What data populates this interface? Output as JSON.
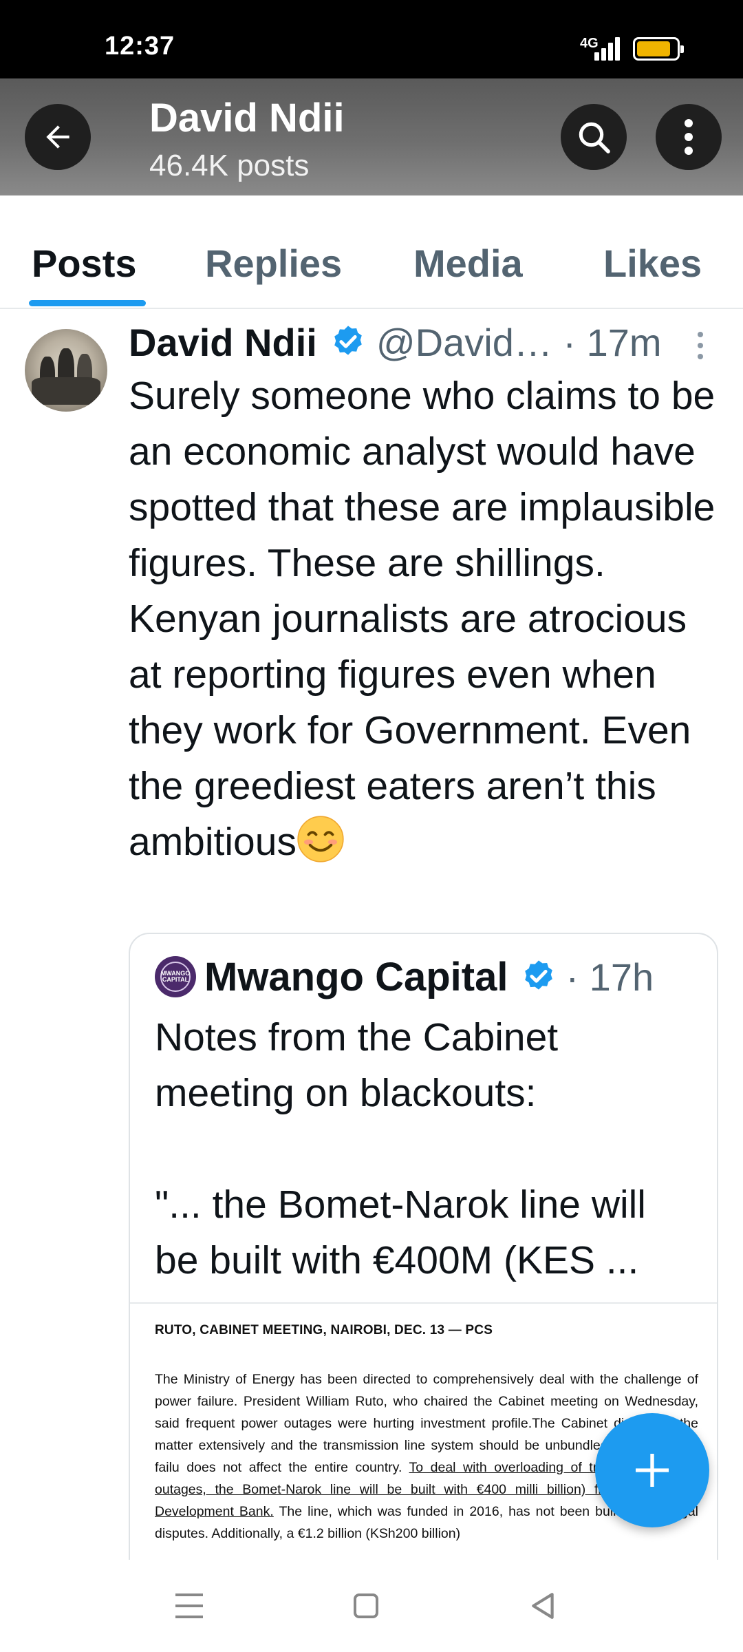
{
  "status_bar": {
    "time": "12:37",
    "network": "4G",
    "battery_color": "#f0b400",
    "battery_level": 0.85
  },
  "header": {
    "name": "David Ndii",
    "post_count": "46.4K posts",
    "back_icon": "arrow-left-icon",
    "search_icon": "search-icon",
    "more_icon": "vertical-dots-icon"
  },
  "tabs": {
    "items": [
      {
        "label": "Posts",
        "active": true
      },
      {
        "label": "Replies",
        "active": false
      },
      {
        "label": "Media",
        "active": false
      },
      {
        "label": "Likes",
        "active": false
      }
    ],
    "accent": "#1d9bf0"
  },
  "post": {
    "author": "David Ndii",
    "handle_time": "@David… · 17m",
    "text": "Surely someone who claims to be an economic analyst would have spotted that these are implausible figures. These are shillings. Kenyan journalists are atrocious at reporting figures even when they work for Government. Even the greediest eaters aren’t this ambitious",
    "emoji": "smiling-face-emoji"
  },
  "quote": {
    "author": "Mwango Capital",
    "time": "· 17h",
    "text_line1": "Notes from the Cabinet meeting  on blackouts:",
    "text_line2": "\"... the Bomet-Narok line will be built with €400M (KES ...",
    "document": {
      "heading": "RUTO, CABINET MEETING, NAIROBI, DEC. 13 — PCS",
      "body_plain": "The Ministry of Energy has been directed to comprehensively deal with the challenge of power failure. President William Ruto, who chaired the Cabinet meeting on Wednesday, said frequent power outages were hurting investment profile.The Cabinet discussed the matter extensively and the transmission line system should be unbundled so that power failu does not affect the entire country. ",
      "body_underlined": "To deal with overloading of trans that causes outages, the Bomet-Narok line will be built with €400 milli billion) from the African Development Bank.",
      "body_tail": " The line, which was funded in 2016, has not been built due to legal disputes. Additionally, a €1.2 billion (KSh200 billion)"
    }
  },
  "fab": {
    "icon": "plus-icon",
    "color": "#1d9bf0"
  },
  "navbar": {
    "menu_icon": "menu-icon",
    "home_icon": "home-square-icon",
    "back_icon": "back-triangle-icon"
  }
}
